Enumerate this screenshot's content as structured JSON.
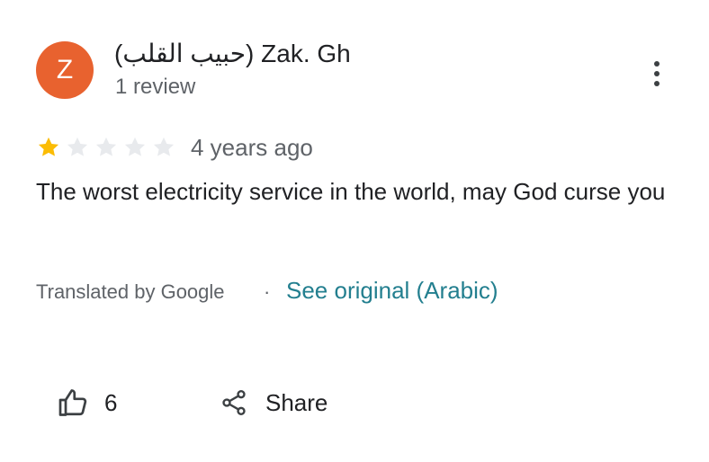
{
  "review": {
    "avatar_letter": "Z",
    "avatar_color": "#e8622f",
    "author_name": "(حبيب القلب) Zak. Gh",
    "review_count": "1 review",
    "rating": 1,
    "rating_max": 5,
    "star_filled_color": "#fbbc04",
    "star_empty_color": "#e8eaed",
    "time_ago": "4 years ago",
    "text": "The worst electricity service in the world, may God curse you",
    "translated_by": "Translated by Google",
    "separator": "·",
    "see_original": "See original (Arabic)",
    "link_color": "#237f8f"
  },
  "actions": {
    "like_icon": "thumb-up-icon",
    "like_count": "6",
    "share_icon": "share-icon",
    "share_label": "Share",
    "more_icon": "more-vert-icon"
  }
}
